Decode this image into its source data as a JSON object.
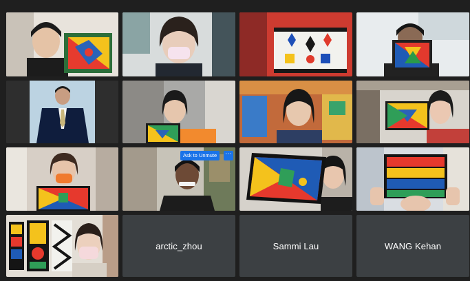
{
  "participants": [
    {
      "id": "p1",
      "kind": "video",
      "icon": "video-feed-icon"
    },
    {
      "id": "p2",
      "kind": "video",
      "icon": "video-feed-icon"
    },
    {
      "id": "p3",
      "kind": "video",
      "icon": "video-feed-icon"
    },
    {
      "id": "p4",
      "kind": "video",
      "icon": "video-feed-icon"
    },
    {
      "id": "p5",
      "kind": "video",
      "icon": "video-feed-icon"
    },
    {
      "id": "p6",
      "kind": "video",
      "icon": "video-feed-icon"
    },
    {
      "id": "p7",
      "kind": "video",
      "icon": "video-feed-icon"
    },
    {
      "id": "p8",
      "kind": "video",
      "icon": "video-feed-icon"
    },
    {
      "id": "p9",
      "kind": "video",
      "icon": "video-feed-icon"
    },
    {
      "id": "p10",
      "kind": "video",
      "icon": "video-feed-icon"
    },
    {
      "id": "p11",
      "kind": "video",
      "icon": "video-feed-icon"
    },
    {
      "id": "p12",
      "kind": "video",
      "icon": "video-feed-icon"
    },
    {
      "id": "p13",
      "kind": "video",
      "icon": "video-feed-icon"
    },
    {
      "id": "p14",
      "kind": "name",
      "name": "arctic_zhou"
    },
    {
      "id": "p15",
      "kind": "name",
      "name": "Sammi Lau"
    },
    {
      "id": "p16",
      "kind": "name",
      "name": "WANG Kehan"
    }
  ],
  "hover_controls": {
    "unmute_label": "Ask to Unmute",
    "more_label": "⋯"
  },
  "colors": {
    "background": "#1f1f1f",
    "name_tile": "#3c4043",
    "accent_blue": "#1a73e8",
    "active_outline": "#8ab4f8"
  }
}
